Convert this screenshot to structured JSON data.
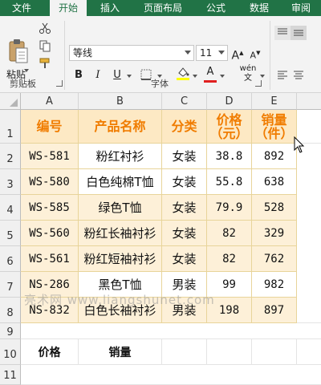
{
  "ribbon_tabs": [
    "文件",
    "开始",
    "插入",
    "页面布局",
    "公式",
    "数据",
    "审阅"
  ],
  "clipboard": {
    "paste_label": "粘贴",
    "group_label": "剪贴板"
  },
  "font": {
    "name": "等线",
    "size": "11",
    "group_label": "字体",
    "grow_font": "A",
    "shrink_font": "A",
    "bold": "B",
    "italic": "I",
    "underline": "U",
    "font_color": "A",
    "phonetic": "wén",
    "phonetic_sub": "文"
  },
  "colors": {
    "excel_green": "#217346",
    "header_text": "#f07c00",
    "header_fill": "#fde9c4",
    "stripe_fill": "#fdf0d8",
    "font_color_bar": "#e02020",
    "fill_color_bar": "#ffff00"
  },
  "sheet": {
    "columns": [
      "A",
      "B",
      "C",
      "D",
      "E"
    ],
    "rows": [
      "1",
      "2",
      "3",
      "4",
      "5",
      "6",
      "7",
      "8",
      "9",
      "10",
      "11"
    ],
    "headers": {
      "a": "编号",
      "b": "产品名称",
      "c": "分类",
      "d": "价格（元）",
      "e": "销量（件）"
    },
    "header_lines": {
      "d1": "价格",
      "d2": "（元）",
      "e1": "销量",
      "e2": "（件）"
    },
    "data": [
      {
        "id": "WS-581",
        "name": "粉红衬衫",
        "cat": "女装",
        "price": "38.8",
        "sales": "892"
      },
      {
        "id": "WS-580",
        "name": "白色纯棉T恤",
        "cat": "女装",
        "price": "55.8",
        "sales": "638"
      },
      {
        "id": "WS-585",
        "name": "绿色T恤",
        "cat": "女装",
        "price": "79.9",
        "sales": "528"
      },
      {
        "id": "WS-560",
        "name": "粉红长袖衬衫",
        "cat": "女装",
        "price": "82",
        "sales": "329"
      },
      {
        "id": "WS-561",
        "name": "粉红短袖衬衫",
        "cat": "女装",
        "price": "82",
        "sales": "762"
      },
      {
        "id": "NS-286",
        "name": "黑色T恤",
        "cat": "男装",
        "price": "99",
        "sales": "982"
      },
      {
        "id": "NS-832",
        "name": "白色长袖衬衫",
        "cat": "男装",
        "price": "198",
        "sales": "897"
      }
    ],
    "row10": {
      "a": "价格",
      "b": "销量"
    }
  },
  "watermark": "亮术网 www.liangshunet.com"
}
